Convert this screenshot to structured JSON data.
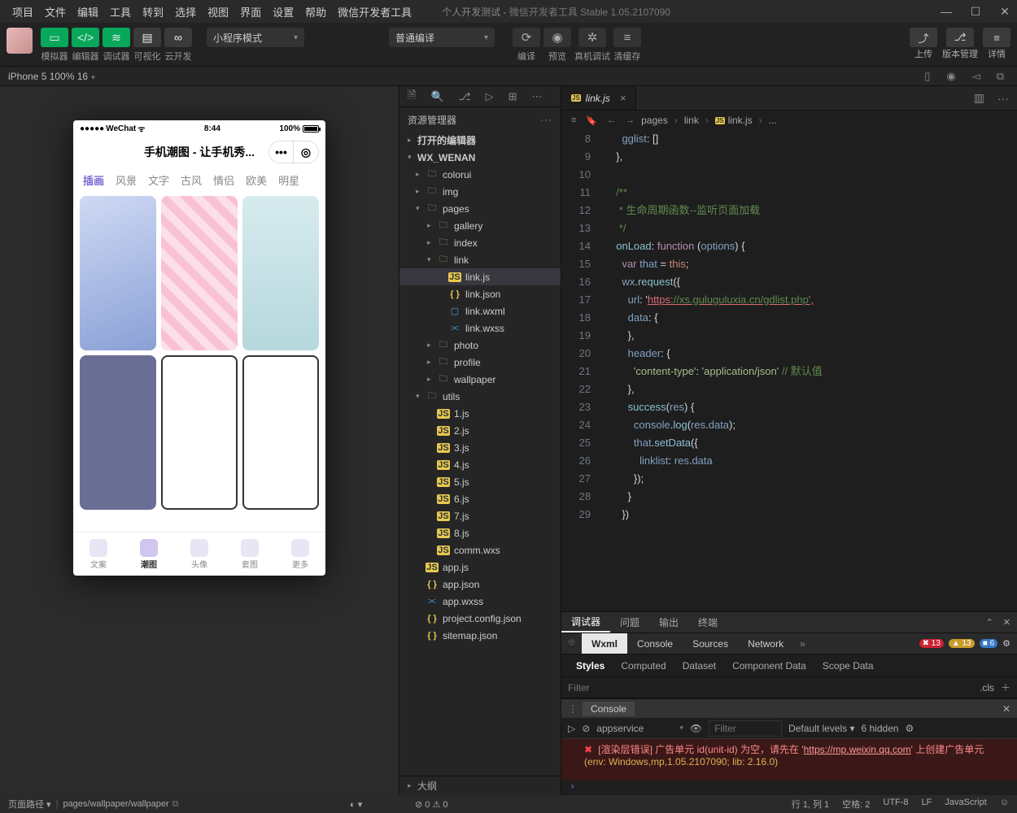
{
  "window": {
    "title_left": "个人开发测试",
    "title_right": "微信开发者工具 Stable 1.05.2107090"
  },
  "menus": [
    "项目",
    "文件",
    "编辑",
    "工具",
    "转到",
    "选择",
    "视图",
    "界面",
    "设置",
    "帮助",
    "微信开发者工具"
  ],
  "toolbar": {
    "sim_labels": [
      "模拟器",
      "编辑器",
      "调试器"
    ],
    "vis_labels": [
      "可视化",
      "云开发"
    ],
    "mode_select": "小程序模式",
    "compile_select": "普通编译",
    "mid_actions": [
      "编译",
      "预览",
      "真机调试",
      "清缓存"
    ],
    "right_actions": [
      "上传",
      "版本管理",
      "详情"
    ]
  },
  "devicebar": {
    "device": "iPhone 5 100% 16"
  },
  "phone": {
    "carrier": "WeChat",
    "time": "8:44",
    "battery": "100%",
    "app_title": "手机潮图 - 让手机秀...",
    "tabs": [
      "插画",
      "风景",
      "文字",
      "古风",
      "情侣",
      "欧美",
      "明星"
    ],
    "nav": [
      "文案",
      "潮图",
      "头像",
      "套图",
      "更多"
    ],
    "nav_active_index": 1
  },
  "explorer": {
    "header": "资源管理器",
    "sections": [
      "打开的编辑器"
    ],
    "project": "WX_WENAN",
    "tree": [
      {
        "type": "folder",
        "name": "colorui",
        "depth": 1,
        "open": false
      },
      {
        "type": "folder",
        "name": "img",
        "depth": 1,
        "open": false,
        "icon": "img"
      },
      {
        "type": "folder",
        "name": "pages",
        "depth": 1,
        "open": true
      },
      {
        "type": "folder",
        "name": "gallery",
        "depth": 2,
        "open": false
      },
      {
        "type": "folder",
        "name": "index",
        "depth": 2,
        "open": false
      },
      {
        "type": "folder",
        "name": "link",
        "depth": 2,
        "open": true
      },
      {
        "type": "file",
        "name": "link.js",
        "depth": 3,
        "ext": "js",
        "sel": true
      },
      {
        "type": "file",
        "name": "link.json",
        "depth": 3,
        "ext": "json"
      },
      {
        "type": "file",
        "name": "link.wxml",
        "depth": 3,
        "ext": "wxml"
      },
      {
        "type": "file",
        "name": "link.wxss",
        "depth": 3,
        "ext": "wxss"
      },
      {
        "type": "folder",
        "name": "photo",
        "depth": 2,
        "open": false
      },
      {
        "type": "folder",
        "name": "profile",
        "depth": 2,
        "open": false
      },
      {
        "type": "folder",
        "name": "wallpaper",
        "depth": 2,
        "open": false
      },
      {
        "type": "folder",
        "name": "utils",
        "depth": 1,
        "open": true,
        "icon": "img"
      },
      {
        "type": "file",
        "name": "1.js",
        "depth": 2,
        "ext": "js"
      },
      {
        "type": "file",
        "name": "2.js",
        "depth": 2,
        "ext": "js"
      },
      {
        "type": "file",
        "name": "3.js",
        "depth": 2,
        "ext": "js"
      },
      {
        "type": "file",
        "name": "4.js",
        "depth": 2,
        "ext": "js"
      },
      {
        "type": "file",
        "name": "5.js",
        "depth": 2,
        "ext": "js"
      },
      {
        "type": "file",
        "name": "6.js",
        "depth": 2,
        "ext": "js"
      },
      {
        "type": "file",
        "name": "7.js",
        "depth": 2,
        "ext": "js"
      },
      {
        "type": "file",
        "name": "8.js",
        "depth": 2,
        "ext": "js"
      },
      {
        "type": "file",
        "name": "comm.wxs",
        "depth": 2,
        "ext": "js"
      },
      {
        "type": "file",
        "name": "app.js",
        "depth": 1,
        "ext": "js"
      },
      {
        "type": "file",
        "name": "app.json",
        "depth": 1,
        "ext": "json"
      },
      {
        "type": "file",
        "name": "app.wxss",
        "depth": 1,
        "ext": "wxss"
      },
      {
        "type": "file",
        "name": "project.config.json",
        "depth": 1,
        "ext": "json"
      },
      {
        "type": "file",
        "name": "sitemap.json",
        "depth": 1,
        "ext": "json"
      }
    ],
    "outline": "大纲"
  },
  "editor": {
    "tab_file": "link.js",
    "breadcrumb": [
      "pages",
      "link",
      "link.js",
      "..."
    ],
    "lines": {
      "start": 8,
      "text": [
        "    gglist: []",
        "  },",
        "",
        "  /**",
        "   * 生命周期函数--监听页面加载",
        "   */",
        "  onLoad: function (options) {",
        "    var that = this;",
        "    wx.request({",
        "      url: 'https://xs.guluguluxia.cn/gdlist.php',",
        "      data: {",
        "      },",
        "      header: {",
        "        'content-type': 'application/json' // 默认值",
        "      },",
        "      success(res) {",
        "        console.log(res.data);",
        "        that.setData({",
        "          linklist: res.data",
        "        });",
        "      }",
        "    })"
      ]
    }
  },
  "debugger": {
    "tabs": [
      "调试器",
      "问题",
      "输出",
      "终端"
    ],
    "devtabs": [
      "Wxml",
      "Console",
      "Sources",
      "Network"
    ],
    "badges": {
      "errors": "13",
      "warnings": "13",
      "info": "6"
    },
    "styletabs": [
      "Styles",
      "Computed",
      "Dataset",
      "Component Data",
      "Scope Data"
    ],
    "filter_placeholder": "Filter",
    "cls_label": ".cls",
    "console_label": "Console",
    "service": "appservice",
    "levels": "Default levels",
    "hidden": "6 hidden",
    "console_error_1": "[渲染层错误] 广告单元 id(unit-id) 为空，请先在 '",
    "console_error_url": "https://mp.weixin.qq.com",
    "console_error_2": "' 上创建广告单元",
    "console_env": "(env: Windows,mp,1.05.2107090; lib: 2.16.0)"
  },
  "statusbar": {
    "route_label": "页面路径",
    "route_value": "pages/wallpaper/wallpaper",
    "diag": "⊘ 0 ⚠ 0",
    "cursor": "行 1, 列 1",
    "spaces": "空格: 2",
    "encoding": "UTF-8",
    "eol": "LF",
    "lang": "JavaScript"
  }
}
